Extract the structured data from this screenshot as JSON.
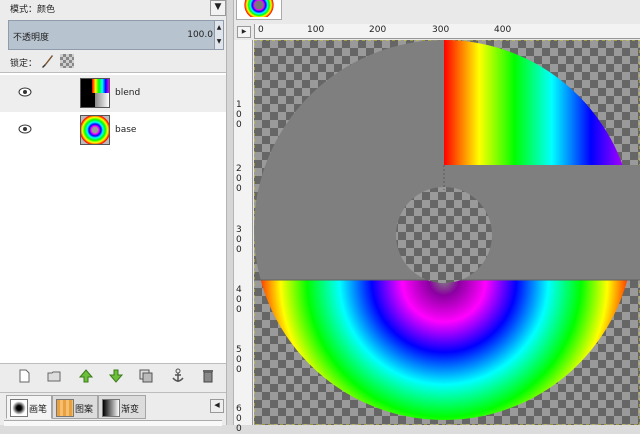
{
  "layers_panel": {
    "mode_label": "模式：颜色",
    "mode_dropdown_arrow": "▼",
    "opacity_label": "不透明度",
    "opacity_value": "100.0",
    "lock_label": "锁定：",
    "layers": [
      {
        "name": "blend",
        "visible": true,
        "thumbnail": "blend-thumbnail"
      },
      {
        "name": "base",
        "visible": true,
        "thumbnail": "base-thumbnail"
      }
    ],
    "buttons": [
      "new-layer-icon",
      "new-layer-group-icon",
      "raise-layer-icon",
      "lower-layer-icon",
      "duplicate-layer-icon",
      "anchor-layer-icon",
      "delete-layer-icon"
    ]
  },
  "dock_tabs": [
    {
      "label": "画笔",
      "icon": "brush-preview-icon"
    },
    {
      "label": "图案",
      "icon": "pattern-preview-icon"
    },
    {
      "label": "渐变",
      "icon": "gradient-preview-icon"
    }
  ],
  "dock_menu_glyph": "◀",
  "canvas_view": {
    "horizontal_ruler_labels": [
      "0",
      "100",
      "200",
      "300",
      "400"
    ],
    "vertical_ruler_labels": [
      "100",
      "200",
      "300",
      "400",
      "500",
      "600"
    ],
    "corner_glyph": "▶"
  },
  "colors": {
    "panel_bg": "#ececec",
    "selection": "#b7c3ce",
    "gray_layer": "#7f7f7f",
    "checker_dark": "#666666",
    "checker_light": "#9a9a9a"
  }
}
